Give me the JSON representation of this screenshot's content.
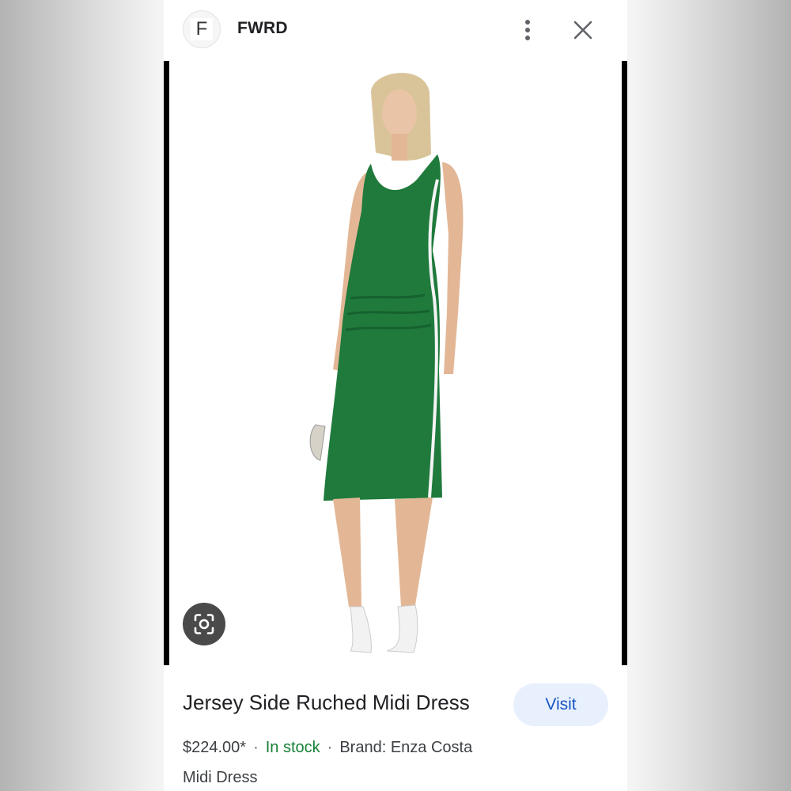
{
  "header": {
    "favicon_letter": "F",
    "site_name": "FWRD",
    "more_icon": "more-vert-icon",
    "close_icon": "close-icon"
  },
  "image": {
    "lens_icon": "lens-search-icon",
    "dress_color": "#1f7a3c"
  },
  "product": {
    "title": "Jersey Side Ruched Midi Dress",
    "visit_label": "Visit",
    "price": "$224.00*",
    "separator": "·",
    "stock": "In stock",
    "brand": "Brand: Enza Costa",
    "brand_continued": "Midi Dress"
  },
  "colors": {
    "stock_green": "#188038",
    "visit_blue": "#1a56c4",
    "visit_bg": "#e8f0fe"
  }
}
